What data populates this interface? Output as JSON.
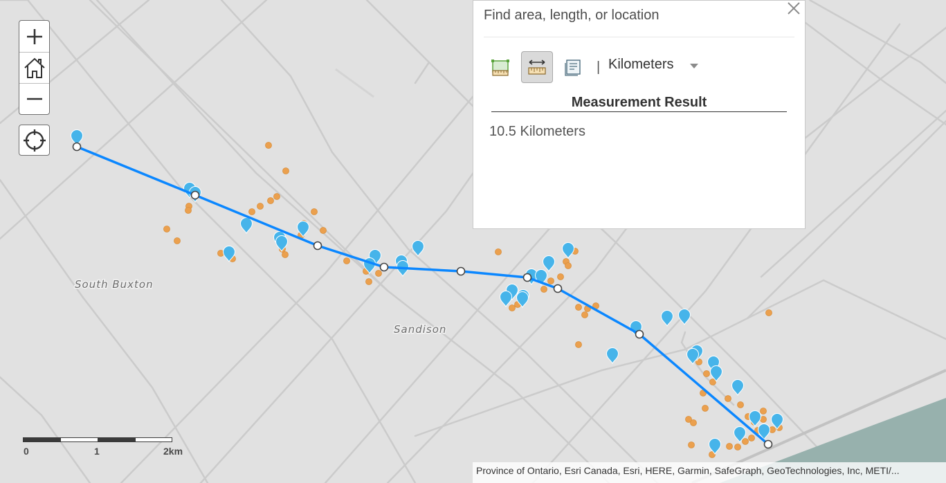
{
  "map": {
    "place_labels": [
      "South Buxton",
      "Sandison"
    ]
  },
  "controls": {
    "zoom_in_icon": "plus-icon",
    "home_icon": "home-icon",
    "zoom_out_icon": "minus-icon",
    "locate_icon": "locate-crosshair-icon"
  },
  "measure": {
    "search_placeholder": "Find area, length, or location",
    "tools": [
      "area-tool-icon",
      "distance-tool-icon",
      "location-tool-icon"
    ],
    "separator": "|",
    "unit": "Kilometers",
    "result_title": "Measurement Result",
    "result_value": "10.5 Kilometers"
  },
  "scalebar": {
    "labels": [
      "0",
      "1",
      "2km"
    ]
  },
  "attribution": "Province of Ontario, Esri Canada, Esri, HERE, Garmin, SafeGraph, GeoTechnologies, Inc, METI/...",
  "colors": {
    "map_background": "#e1e1e1",
    "road": "#c9c9c9",
    "water": "#97b1ad",
    "measure_line": "#0b87ff",
    "blue_marker": "#46b4ea",
    "orange_marker": "#eba04e"
  }
}
